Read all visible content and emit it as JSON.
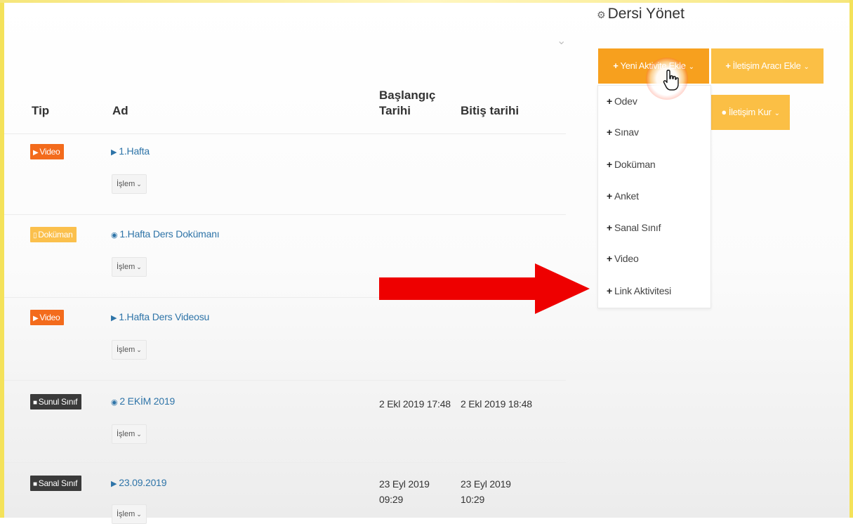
{
  "table": {
    "headers": {
      "tip": "Tip",
      "ad": "Ad",
      "start_line1": "Başlangıç",
      "start_line2": "Tarihi",
      "end": "Bitiş tarihi"
    },
    "action_label": "İşlem",
    "rows": [
      {
        "type_label": "Video",
        "type_kind": "video",
        "name": "1.Hafta",
        "start": "",
        "end": ""
      },
      {
        "type_label": "Doküman",
        "type_kind": "document",
        "name": "1.Hafta Ders Dokümanı",
        "start": "",
        "end": ""
      },
      {
        "type_label": "Video",
        "type_kind": "video",
        "name": "1.Hafta Ders Videosu",
        "start": "",
        "end": ""
      },
      {
        "type_label": "Sunul Sınıf",
        "type_kind": "virtual-class",
        "name": "2 EKİM 2019",
        "start": "2 Ekl 2019 17:48",
        "end": "2 Ekl 2019 18:48"
      },
      {
        "type_label": "Sanal Sınıf",
        "type_kind": "virtual-class",
        "name": "23.09.2019",
        "start_line1": "23 Eyl 2019",
        "start_line2": "09:29",
        "end_line1": "23 Eyl 2019",
        "end_line2": "10:29"
      }
    ]
  },
  "manage": {
    "title": "Dersi Yönet",
    "new_activity": "Yeni Aktivite Ekle",
    "add_contact_tool": "İletişim Aracı Ekle",
    "contact": "İletişim Kur"
  },
  "dropdown": {
    "items": [
      "Odev",
      "Sınav",
      "Doküman",
      "Anket",
      "Sanal Sınıf",
      "Video",
      "Link Aktivitesi"
    ]
  },
  "colors": {
    "video_badge": "#f36b1c",
    "document_badge": "#fbc04c",
    "virtual_badge": "#3a3a3a",
    "primary_button": "#f7a01e",
    "secondary_button": "#fbbf45",
    "link": "#2e74a8",
    "annotation_arrow": "#ee0000"
  },
  "icons": {
    "video": "play-icon",
    "document": "file-icon",
    "virtual": "camera-icon",
    "view": "eye-icon",
    "manage": "gears-icon",
    "add": "plus-icon",
    "cursor": "hand-pointer-icon"
  }
}
